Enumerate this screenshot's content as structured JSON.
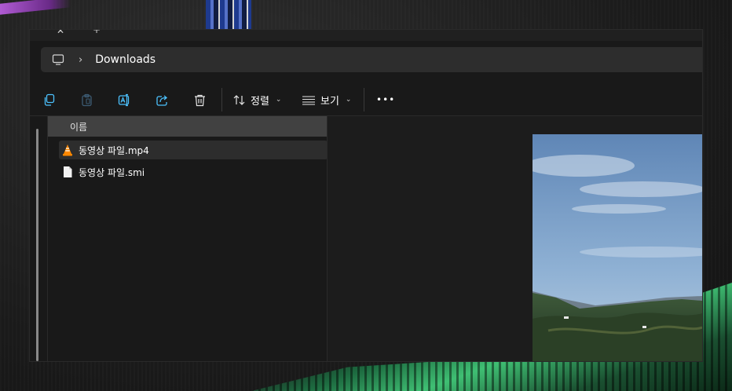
{
  "address_bar": {
    "location": "Downloads"
  },
  "toolbar": {
    "sort_label": "정렬",
    "view_label": "보기",
    "more_label": "•••"
  },
  "file_list": {
    "column_header": "이름",
    "files": [
      {
        "name": "동영상 파일.mp4",
        "icon": "vlc-icon",
        "selected": true
      },
      {
        "name": "동영상 파일.smi",
        "icon": "document-icon",
        "selected": false
      }
    ]
  },
  "colors": {
    "window_bg": "#191919",
    "address_bg": "#2d2d2d",
    "header_bg": "#414141",
    "selected_bg": "#2d2d2d",
    "accent_blue": "#4cc2ff",
    "vlc_orange": "#ff8800"
  }
}
